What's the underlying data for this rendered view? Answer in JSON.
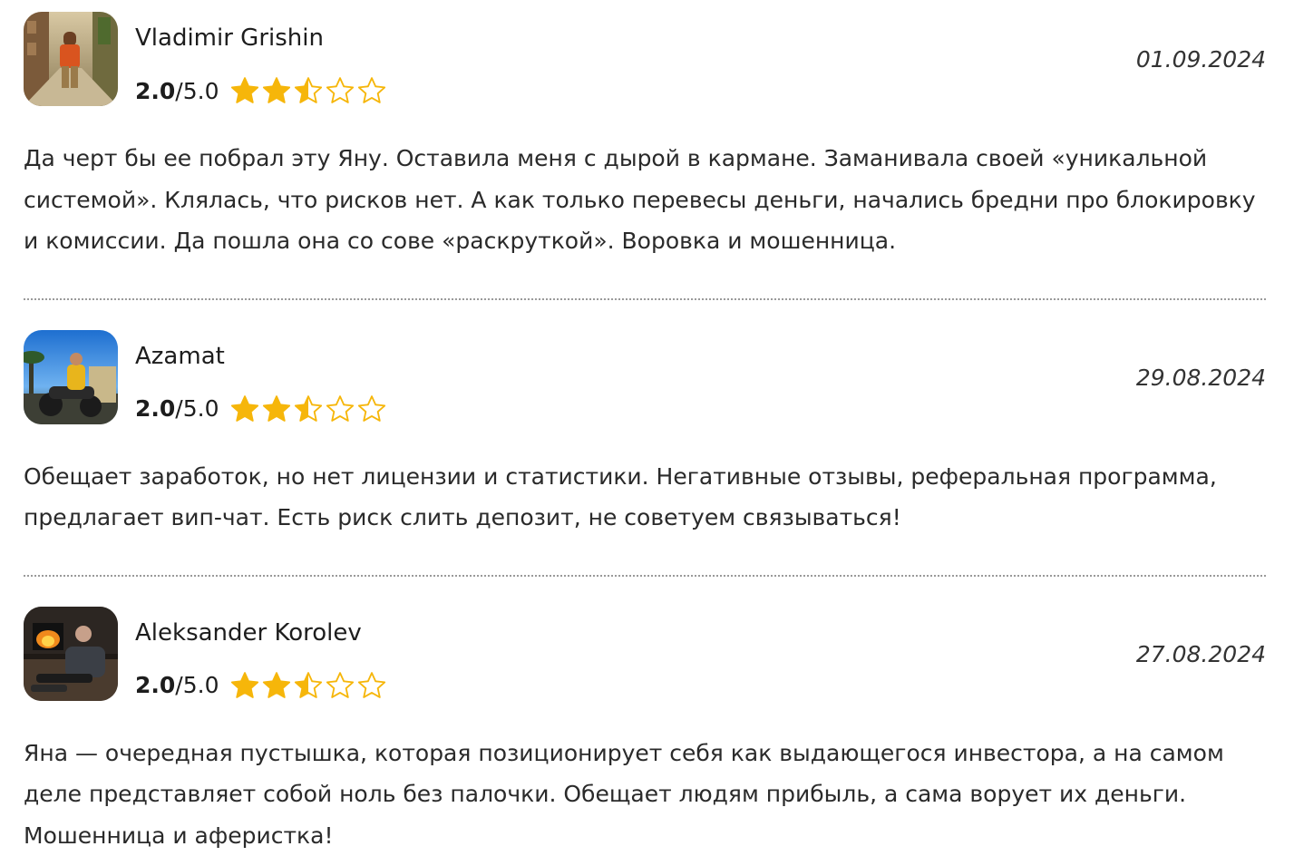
{
  "colors": {
    "star_filled": "#f6b60a",
    "star_empty_outline": "#f6b60a",
    "divider": "#9a9a9a",
    "text": "#2a2a2a"
  },
  "reviews": [
    {
      "author": "Vladimir Grishin",
      "score": "2.0",
      "score_max": "/5.0",
      "stars": 2.5,
      "date": "01.09.2024",
      "avatar": "photo-man-street",
      "text": "Да черт бы ее побрал эту Яну. Оставила меня с дырой в кармане. Заманивала своей «уникальной системой». Клялась, что рисков нет. А как только перевесы деньги, начались бредни про блокировку и комиссии. Да пошла она со сове «раскруткой». Воровка и мошенница."
    },
    {
      "author": "Azamat",
      "score": "2.0",
      "score_max": "/5.0",
      "stars": 2.5,
      "date": "29.08.2024",
      "avatar": "photo-man-motorbike",
      "text": "Обещает заработок, но нет лицензии и статистики. Негативные отзывы, реферальная программа, предлагает вип-чат. Есть риск слить депозит, не советуем связываться!"
    },
    {
      "author": "Aleksander Korolev",
      "score": "2.0",
      "score_max": "/5.0",
      "stars": 2.5,
      "date": "27.08.2024",
      "avatar": "photo-man-fireplace",
      "text": "Яна — очередная пустышка, которая позиционирует себя как выдающегося инвестора, а на самом деле представляет собой ноль без палочки. Обещает людям прибыль, а сама ворует их деньги. Мошенница и аферистка!"
    }
  ]
}
